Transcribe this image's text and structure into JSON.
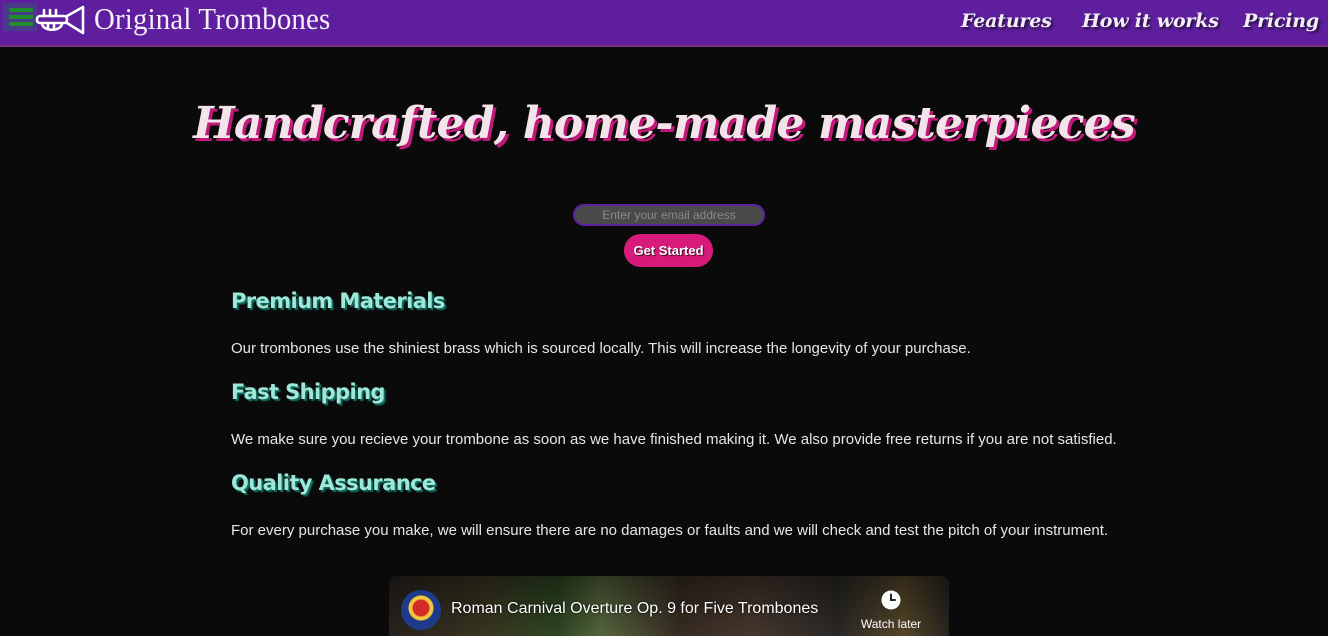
{
  "header": {
    "brand": "Original Trombones",
    "nav": [
      {
        "label": "Features"
      },
      {
        "label": "How it works"
      },
      {
        "label": "Pricing"
      }
    ]
  },
  "hero": {
    "title": "Handcrafted, home-made masterpieces",
    "email_placeholder": "Enter your email address",
    "cta_label": "Get Started"
  },
  "features": [
    {
      "title": "Premium Materials",
      "text": "Our trombones use the shiniest brass which is sourced locally. This will increase the longevity of your purchase."
    },
    {
      "title": "Fast Shipping",
      "text": "We make sure you recieve your trombone as soon as we have finished making it. We also provide free returns if you are not satisfied."
    },
    {
      "title": "Quality Assurance",
      "text": "For every purchase you make, we will ensure there are no damages or faults and we will check and test the pitch of your instrument."
    }
  ],
  "video": {
    "title": "Roman Carnival Overture Op. 9 for Five Trombones",
    "watch_later_label": "Watch later"
  },
  "colors": {
    "header_bg": "#5e1e9e",
    "page_bg": "#0a0a0a",
    "accent_pink": "#d81b7b",
    "feature_title": "#9fe8d8"
  },
  "icons": {
    "menu": "hamburger-menu-icon",
    "logo": "trumpet-icon",
    "watch_later": "clock-icon"
  }
}
